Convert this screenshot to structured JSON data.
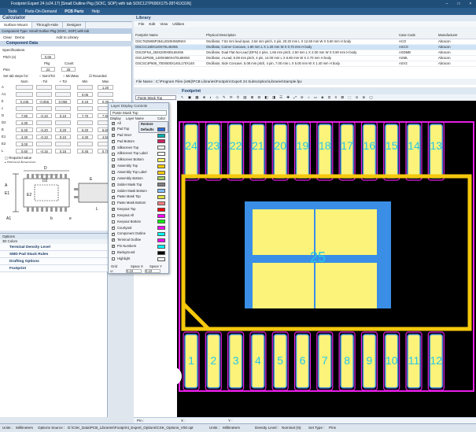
{
  "window": {
    "title": "Footprint Expert 24 (v24.17) [Small Outline Pkg (SOIC, SOP) with tab SOIC127P600X175-28T41X31N]"
  },
  "menu": {
    "items": [
      "Tools",
      "Parts-On-Demand",
      "PCB Partz",
      "Help"
    ]
  },
  "calculator": {
    "title": "Calculator",
    "tabs": [
      "Surface Mount",
      "Through-Hole",
      "Designer"
    ],
    "component_type": "Component Type: Small Outline Pkg (SOIC, SOP) with tab",
    "clear": "Clear",
    "demo": "Demo",
    "add": "Add to Library"
  },
  "component_data": {
    "title": "Component Data",
    "specifications": "Specifications",
    "pitch_label": "Pitch (e)",
    "pitch": "0.65",
    "pkg_label": "Pkg",
    "count_label": "Count",
    "pins_label": "Pins",
    "pins": "28",
    "pkg_count": "24",
    "count": "24",
    "tab_steps_label": "Set tab steps for:",
    "tab_steps": [
      "Nom/Tol",
      "Min/Max",
      "Rounded"
    ],
    "col_headers": [
      "Nom",
      "- Tol",
      "+ Tol",
      "Min",
      "Max"
    ],
    "rows": [
      {
        "label": "A",
        "nom": "",
        "mtol": "",
        "ptol": "",
        "min": "",
        "max": "1.20"
      },
      {
        "label": "A1",
        "nom": "",
        "mtol": "",
        "ptol": "",
        "min": "0.05",
        "max": ""
      },
      {
        "label": "b",
        "nom": "0.245",
        "mtol": "-0.055",
        "ptol": "0.055",
        "min": "0.19",
        "max": "0.30"
      },
      {
        "label": "c",
        "nom": "",
        "mtol": "",
        "ptol": "",
        "min": "",
        "max": ""
      },
      {
        "label": "D",
        "nom": "7.80",
        "mtol": "-0.10",
        "ptol": "0.10",
        "min": "7.70",
        "max": "7.90"
      },
      {
        "label": "D2",
        "nom": "4.30",
        "mtol": "",
        "ptol": "",
        "min": "",
        "max": ""
      },
      {
        "label": "E",
        "nom": "6.40",
        "mtol": "-0.20",
        "ptol": "0.20",
        "min": "6.20",
        "max": "6.60"
      },
      {
        "label": "E1",
        "nom": "4.40",
        "mtol": "-0.10",
        "ptol": "0.10",
        "min": "4.30",
        "max": "4.50"
      },
      {
        "label": "E2",
        "nom": "3.00",
        "mtol": "",
        "ptol": "",
        "min": "",
        "max": ""
      },
      {
        "label": "L",
        "nom": "0.60",
        "mtol": "-0.15",
        "ptol": "0.15",
        "min": "0.45",
        "max": "0.75"
      }
    ],
    "required": "Required value",
    "optional": "Optional dimension"
  },
  "options": {
    "title": "Options",
    "colors": "3D Colors",
    "rows": [
      "Terminal Density Level",
      "SMD Pad Stack Rules",
      "Drafting Options",
      "Footprint"
    ]
  },
  "library": {
    "title": "Library",
    "menu": [
      "File",
      "Edit",
      "View",
      "Utilities"
    ],
    "headers": [
      "Footprint Name",
      "Physical Description",
      "Case Code",
      "Manufacturer"
    ],
    "rows": [
      [
        "OSC762W65P254L2020H550N04",
        "Oscillator, 7.62 mm lead span, 2.54 mm pitch, 4 pin, 20.20 mm L X 12.60 mm W X 5.50 mm H body",
        "ACO",
        "Abracon"
      ],
      [
        "OSCCC180X120X70L45X55",
        "Oscillator, Corner Concave, 1.80 mm L X 1.20 mm W X 0.70 mm H body",
        "ASCO",
        "Abracon"
      ],
      [
        "OSCDFN4_250X200X90L65X55",
        "Oscillator, Dual Flat No-Lead (DFN) 4 pins, 1.65 mm pitch, 2.50 mm L X 2.00 mm W X 0.90 mm H body",
        "ASDMB",
        "Abracon"
      ],
      [
        "OSCJ4P508_1400X680X470L68X50",
        "Oscillator, J-Lead, 5.08 mm pitch, 4 pin, 14.00 mm L X 6.80 mm W X 4.70 mm H body",
        "ASML",
        "Abracon"
      ],
      [
        "OSCSC4P508_700X500X140L170X140",
        "Oscillator, Side Concave, 5.08 mm pitch, 4 pin, 7.00 mm L X 5.00 mm W X 1.40 mm H body",
        "ASV2",
        "Abracon"
      ]
    ],
    "file_label": "File Name :",
    "file": "C:\\Program Files (x86)\\PCB Libraries\\Footprint Expert 24 Subscription\\Libraries\\Sample.fpx"
  },
  "footprint": {
    "title": "Footprint",
    "layer_combo": "Paste Mask Top",
    "center_pin": "25",
    "top_pins": [
      "24",
      "23",
      "22",
      "21",
      "20",
      "19",
      "18",
      "17",
      "16",
      "15",
      "14",
      "13"
    ],
    "bottom_pins": [
      "1",
      "2",
      "3",
      "4",
      "5",
      "6",
      "7",
      "8",
      "9",
      "10",
      "11",
      "12"
    ]
  },
  "layer_dialog": {
    "title": "Layer Display Controls",
    "combo": "Paste Mask Top",
    "cols": [
      "Display",
      "Layer Name",
      "Color"
    ],
    "all": "All",
    "restore": "Restore Defaults",
    "layers": [
      {
        "name": "Pad Top",
        "on": true,
        "color": "#2c6bd9"
      },
      {
        "name": "Pad Inner",
        "on": true,
        "color": "#00b0b0"
      },
      {
        "name": "Pad Bottom",
        "on": true,
        "color": "#d02060"
      },
      {
        "name": "Silkscreen Top",
        "on": true,
        "color": "#ffffff"
      },
      {
        "name": "Silkscreen Top Label",
        "on": false,
        "color": "#ffffff"
      },
      {
        "name": "Silkscreen Bottom",
        "on": false,
        "color": "#ffff66"
      },
      {
        "name": "Assembly Top",
        "on": true,
        "color": "#ffcc00"
      },
      {
        "name": "Assembly Top Label",
        "on": false,
        "color": "#ffcc00"
      },
      {
        "name": "Assembly Bottom",
        "on": false,
        "color": "#a0d060"
      },
      {
        "name": "Solder Mask Top",
        "on": true,
        "color": "#808080"
      },
      {
        "name": "Solder Mask Bottom",
        "on": false,
        "color": "#80c0ff"
      },
      {
        "name": "Paste Mask Top",
        "on": true,
        "color": "#e0e040"
      },
      {
        "name": "Paste Mask Bottom",
        "on": false,
        "color": "#ff8080"
      },
      {
        "name": "Keepout Top",
        "on": true,
        "color": "#ff0000"
      },
      {
        "name": "Keepout All",
        "on": false,
        "color": "#ff00ff"
      },
      {
        "name": "Keepout Bottom",
        "on": false,
        "color": "#00ff00"
      },
      {
        "name": "Courtyard",
        "on": true,
        "color": "#ff00ff"
      },
      {
        "name": "Component Outline",
        "on": true,
        "color": "#00ffff"
      },
      {
        "name": "Terminal Outline",
        "on": true,
        "color": "#ff00ff"
      },
      {
        "name": "Pin Numbers",
        "on": true,
        "color": "#00ffff"
      },
      {
        "name": "Background",
        "on": false,
        "color": "#000000"
      },
      {
        "name": "Highlight",
        "on": false,
        "color": "#ffffff"
      }
    ],
    "grid_label": "Grid",
    "space_x": "Space X",
    "space_y": "Space Y",
    "grid_x": "0.10",
    "grid_y": "0.10"
  },
  "pinbar": {
    "pin": "Pin :",
    "x": "X :",
    "y": "Y :"
  },
  "status": {
    "units_label": "Units :",
    "units": "Millimeters",
    "opt_label": "Options Source :",
    "opt": "D:\\CSK_Data\\PCB_Libraries\\Footprint_Expert_Options\\CSK_Options_V00.opt",
    "units2_label": "Units :",
    "units2": "Millimeters",
    "density_label": "Density Level :",
    "density": "Nominal (N)",
    "settype_label": "Set Type :",
    "settype": "Pins"
  },
  "colors": {
    "pad": "#fcf37a",
    "pad_border": "#3c8be0",
    "courtyard": "#e61ee6",
    "silk": "#ffffff",
    "assembly": "#f5c80c",
    "thermal": "#3a8ee6",
    "pinnum": "#24c6e8"
  }
}
